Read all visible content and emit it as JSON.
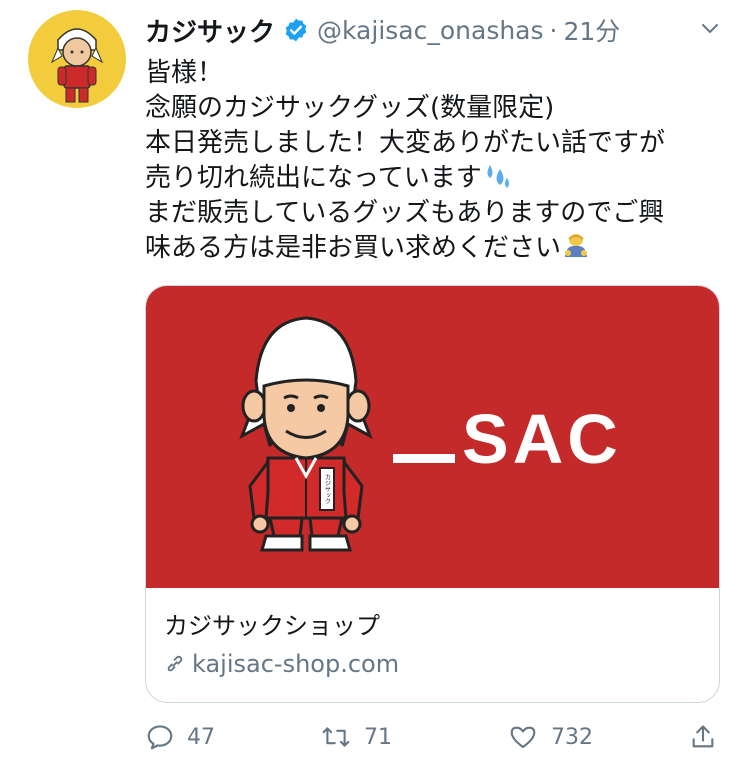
{
  "tweet": {
    "author_name": "カジサック",
    "handle": "@kajisac_onashas",
    "separator": "·",
    "time": "21分",
    "lines": [
      "皆様！",
      "念願のカジサックグッズ(数量限定)",
      "本日発売しました！大変ありがたい話ですが",
      "売り切れ続出になっています",
      "まだ販売しているグッズもありますのでご興",
      "味ある方は是非お買い求めください"
    ],
    "line4_emoji": "sweat-droplets",
    "line6_emoji": "person-bowing"
  },
  "card": {
    "logo_text": "SAC",
    "jacket_text": "カジサック",
    "title": "カジサックショップ",
    "url": "kajisac-shop.com",
    "bg_color": "#c42a29"
  },
  "actions": {
    "reply_count": "47",
    "retweet_count": "71",
    "like_count": "732"
  },
  "colors": {
    "verified": "#1da1f2",
    "secondary_text": "#657786",
    "avatar_bg": "#f2cc3c"
  }
}
